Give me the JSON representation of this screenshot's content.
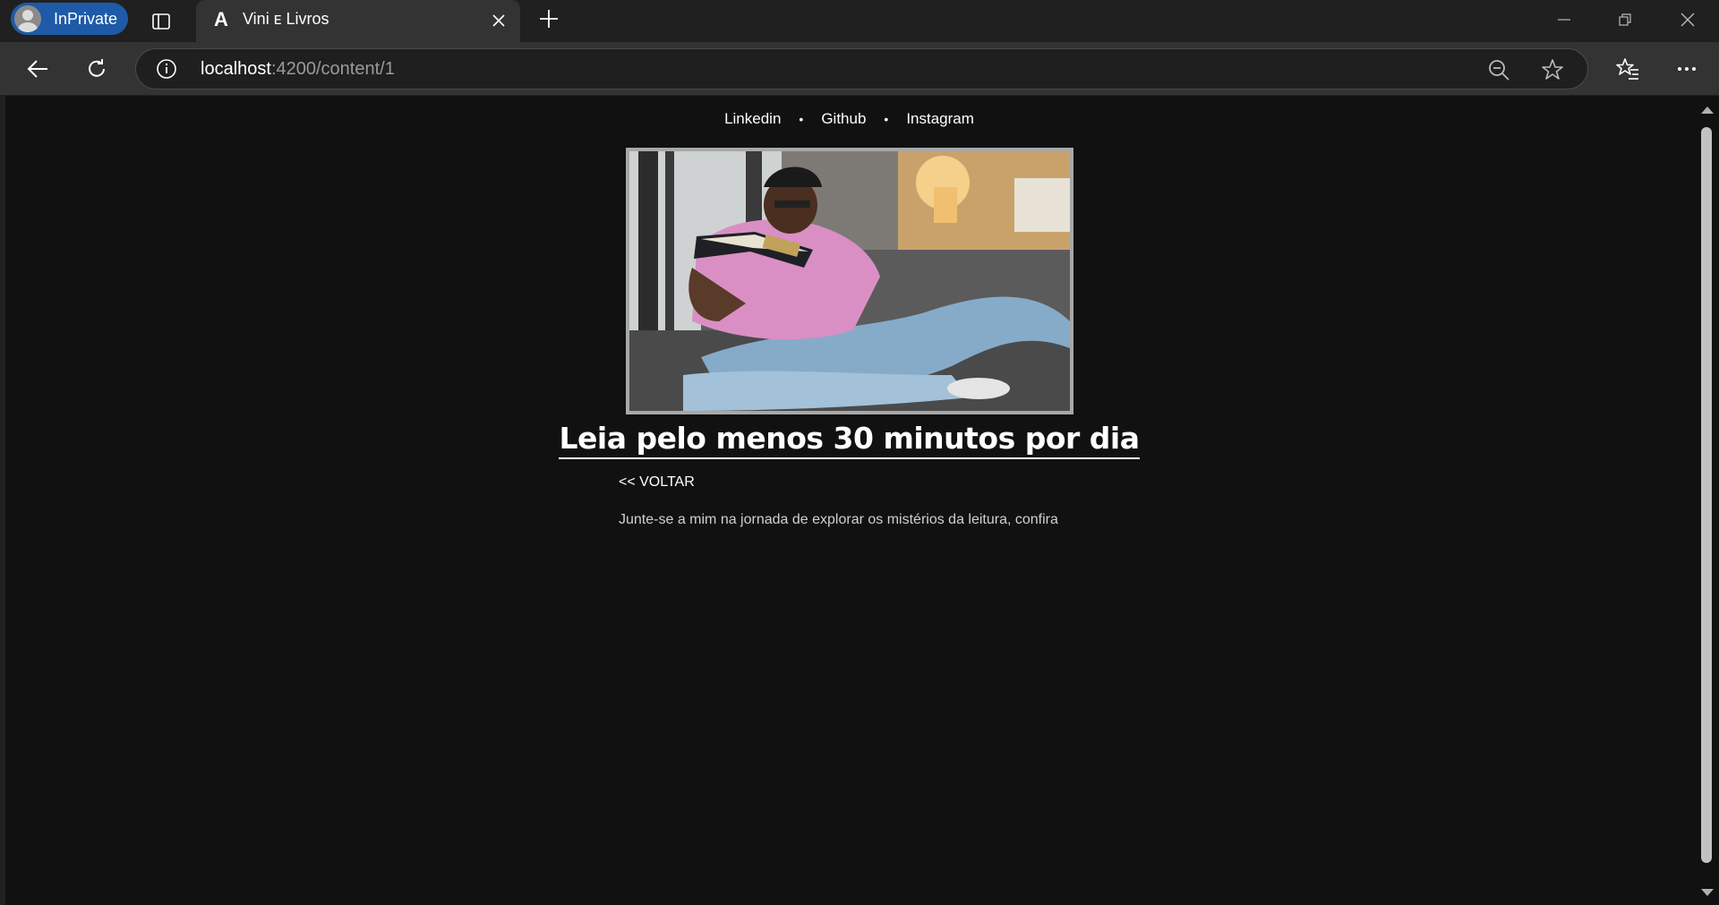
{
  "browser": {
    "profile_label": "InPrivate",
    "tab": {
      "title": "Vini ᴇ Livros",
      "favicon_letter": "A"
    },
    "url_host": "localhost",
    "url_path": ":4200/content/1",
    "accent": "#1e5aa8"
  },
  "page": {
    "social_links": [
      "Linkedin",
      "Github",
      "Instagram"
    ],
    "separator": "•",
    "headline": "Leia pelo menos 30 minutos por dia",
    "back_label": "<< VOLTAR",
    "body": "Junte-se a mim na jornada de explorar os mistérios da leitura, confira",
    "background": "#111111"
  }
}
